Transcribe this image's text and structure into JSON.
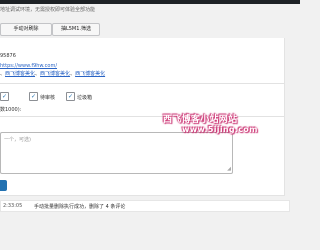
{
  "notice": "地址调试环境，无需授权即可体验全部功能",
  "buttons": {
    "manual": "手动对刷除",
    "lottery": "抽L5M1.筛选"
  },
  "form": {
    "id_value": "95876",
    "site_url": "https://www.f9hw.com/",
    "links": [
      "西飞博客美化",
      "西飞博客美化",
      "西飞博客美化"
    ],
    "options": [
      "待审核",
      "垃圾箱"
    ],
    "limit_label": "数1000):",
    "textarea_placeholder": "一个，可选)"
  },
  "log": {
    "time": "2:33:05",
    "message": "手动批量删除执行成功，删除了 4 条评论"
  },
  "watermark": {
    "line1": "西飞博客小站网站",
    "line2": "www.5ijing.com"
  },
  "colors": {
    "accent": "#2271b1",
    "link": "#2a64c5",
    "watermark_glow": "#d43a7a"
  }
}
